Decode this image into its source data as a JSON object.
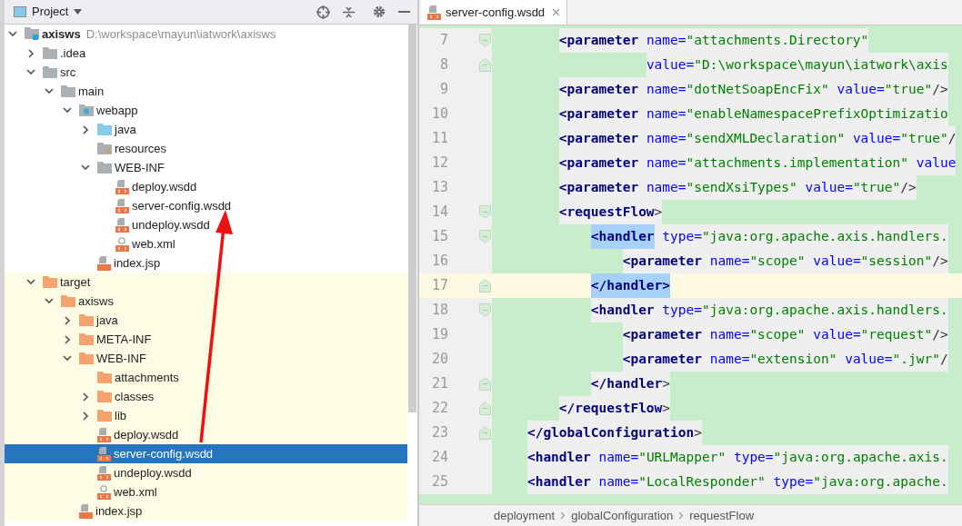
{
  "project_panel": {
    "title": "Project",
    "tree": [
      {
        "name": "axisws",
        "kind": "module",
        "path": "D:\\workspace\\mayun\\iatwork\\axisws",
        "expanded": true,
        "selected": false,
        "children": [
          {
            "name": ".idea",
            "kind": "folder",
            "expanded": false,
            "selected": false
          },
          {
            "name": "src",
            "kind": "folder",
            "expanded": true,
            "selected": false,
            "children": [
              {
                "name": "main",
                "kind": "folder",
                "expanded": true,
                "selected": false,
                "children": [
                  {
                    "name": "webapp",
                    "kind": "web-folder",
                    "expanded": true,
                    "selected": false,
                    "children": [
                      {
                        "name": "java",
                        "kind": "source-folder",
                        "expanded": false,
                        "selected": false
                      },
                      {
                        "name": "resources",
                        "kind": "resource-folder",
                        "selected": false
                      },
                      {
                        "name": "WEB-INF",
                        "kind": "folder",
                        "expanded": true,
                        "selected": false,
                        "children": [
                          {
                            "name": "deploy.wsdd",
                            "kind": "wsdd",
                            "selected": false
                          },
                          {
                            "name": "server-config.wsdd",
                            "kind": "wsdd",
                            "selected": false
                          },
                          {
                            "name": "undeploy.wsdd",
                            "kind": "wsdd",
                            "selected": false
                          },
                          {
                            "name": "web.xml",
                            "kind": "xml",
                            "selected": false
                          }
                        ]
                      },
                      {
                        "name": "index.jsp",
                        "kind": "jsp",
                        "selected": false
                      }
                    ]
                  }
                ]
              }
            ]
          },
          {
            "name": "target",
            "kind": "excluded-folder",
            "expanded": true,
            "selected": false,
            "children": [
              {
                "name": "axisws",
                "kind": "excluded-folder",
                "expanded": true,
                "selected": false,
                "children": [
                  {
                    "name": "java",
                    "kind": "excluded-folder",
                    "expanded": false,
                    "selected": false
                  },
                  {
                    "name": "META-INF",
                    "kind": "excluded-folder",
                    "expanded": false,
                    "selected": false
                  },
                  {
                    "name": "WEB-INF",
                    "kind": "excluded-folder",
                    "expanded": true,
                    "selected": false,
                    "children": [
                      {
                        "name": "attachments",
                        "kind": "excluded-folder",
                        "selected": false
                      },
                      {
                        "name": "classes",
                        "kind": "excluded-folder",
                        "expanded": false,
                        "selected": false
                      },
                      {
                        "name": "lib",
                        "kind": "excluded-folder",
                        "expanded": false,
                        "selected": false
                      },
                      {
                        "name": "deploy.wsdd",
                        "kind": "wsdd",
                        "selected": false
                      },
                      {
                        "name": "server-config.wsdd",
                        "kind": "wsdd",
                        "selected": true
                      },
                      {
                        "name": "undeploy.wsdd",
                        "kind": "wsdd",
                        "selected": false
                      },
                      {
                        "name": "web.xml",
                        "kind": "xml",
                        "selected": false
                      }
                    ]
                  },
                  {
                    "name": "index.jsp",
                    "kind": "jsp",
                    "selected": false
                  }
                ]
              }
            ]
          }
        ]
      }
    ]
  },
  "editor": {
    "tabs": [
      {
        "label": "server-config.wsdd",
        "selected": true
      }
    ],
    "lines": [
      {
        "number": "7",
        "kind": "fold-start",
        "current": false,
        "tokens": [
          {
            "kind": "tag",
            "text": "        <parameter"
          },
          {
            "kind": "attr",
            "text": " name="
          },
          {
            "kind": "string",
            "text": "\"attachments.Directory\""
          }
        ]
      },
      {
        "number": "8",
        "kind": "fold-end",
        "current": false,
        "tokens": [
          {
            "kind": "attr",
            "text": "                   value="
          },
          {
            "kind": "string",
            "text": "\"D:\\workspace\\mayun\\iatwork\\axis"
          }
        ]
      },
      {
        "number": "9",
        "kind": "plain",
        "current": false,
        "tokens": [
          {
            "kind": "tag",
            "text": "        <parameter"
          },
          {
            "kind": "attr",
            "text": " name="
          },
          {
            "kind": "string",
            "text": "\"dotNetSoapEncFix\""
          },
          {
            "kind": "attr",
            "text": " value="
          },
          {
            "kind": "string",
            "text": "\"true\""
          },
          {
            "kind": "punct",
            "text": "/>"
          }
        ]
      },
      {
        "number": "10",
        "kind": "plain",
        "current": false,
        "tokens": [
          {
            "kind": "tag",
            "text": "        <parameter"
          },
          {
            "kind": "attr",
            "text": " name="
          },
          {
            "kind": "string",
            "text": "\"enableNamespacePrefixOptimizatio"
          }
        ]
      },
      {
        "number": "11",
        "kind": "plain",
        "current": false,
        "tokens": [
          {
            "kind": "tag",
            "text": "        <parameter"
          },
          {
            "kind": "attr",
            "text": " name="
          },
          {
            "kind": "string",
            "text": "\"sendXMLDeclaration\""
          },
          {
            "kind": "attr",
            "text": " value="
          },
          {
            "kind": "string",
            "text": "\"true\""
          },
          {
            "kind": "punct",
            "text": "/"
          }
        ]
      },
      {
        "number": "12",
        "kind": "plain",
        "current": false,
        "tokens": [
          {
            "kind": "tag",
            "text": "        <parameter"
          },
          {
            "kind": "attr",
            "text": " name="
          },
          {
            "kind": "string",
            "text": "\"attachments.implementation\""
          },
          {
            "kind": "attr",
            "text": " value"
          }
        ]
      },
      {
        "number": "13",
        "kind": "plain",
        "current": false,
        "tokens": [
          {
            "kind": "tag",
            "text": "        <parameter"
          },
          {
            "kind": "attr",
            "text": " name="
          },
          {
            "kind": "string",
            "text": "\"sendXsiTypes\""
          },
          {
            "kind": "attr",
            "text": " value="
          },
          {
            "kind": "string",
            "text": "\"true\""
          },
          {
            "kind": "punct",
            "text": "/>"
          }
        ]
      },
      {
        "number": "14",
        "kind": "fold-start",
        "current": false,
        "tokens": [
          {
            "kind": "tag",
            "text": "        <requestFlow"
          },
          {
            "kind": "punct",
            "text": ">"
          }
        ]
      },
      {
        "number": "15",
        "kind": "fold-start",
        "current": false,
        "tokens": [
          {
            "kind": "matched",
            "text": "            <handler"
          },
          {
            "kind": "attr",
            "text": " type="
          },
          {
            "kind": "string",
            "text": "\"java:org.apache.axis.handlers."
          }
        ]
      },
      {
        "number": "16",
        "kind": "plain",
        "current": false,
        "tokens": [
          {
            "kind": "tag",
            "text": "                <parameter"
          },
          {
            "kind": "attr",
            "text": " name="
          },
          {
            "kind": "string",
            "text": "\"scope\""
          },
          {
            "kind": "attr",
            "text": " value="
          },
          {
            "kind": "string",
            "text": "\"session\""
          },
          {
            "kind": "punct",
            "text": "/>"
          }
        ]
      },
      {
        "number": "17",
        "kind": "fold-end",
        "current": true,
        "tokens": [
          {
            "kind": "matched",
            "text": "            </handler>"
          }
        ]
      },
      {
        "number": "18",
        "kind": "fold-start",
        "current": false,
        "tokens": [
          {
            "kind": "tag",
            "text": "            <handler"
          },
          {
            "kind": "attr",
            "text": " type="
          },
          {
            "kind": "string",
            "text": "\"java:org.apache.axis.handlers."
          }
        ]
      },
      {
        "number": "19",
        "kind": "plain",
        "current": false,
        "tokens": [
          {
            "kind": "tag",
            "text": "                <parameter"
          },
          {
            "kind": "attr",
            "text": " name="
          },
          {
            "kind": "string",
            "text": "\"scope\""
          },
          {
            "kind": "attr",
            "text": " value="
          },
          {
            "kind": "string",
            "text": "\"request\""
          },
          {
            "kind": "punct",
            "text": "/>"
          }
        ]
      },
      {
        "number": "20",
        "kind": "plain",
        "current": false,
        "tokens": [
          {
            "kind": "tag",
            "text": "                <parameter"
          },
          {
            "kind": "attr",
            "text": " name="
          },
          {
            "kind": "string",
            "text": "\"extension\""
          },
          {
            "kind": "attr",
            "text": " value="
          },
          {
            "kind": "string",
            "text": "\".jwr\""
          },
          {
            "kind": "punct",
            "text": "/"
          }
        ]
      },
      {
        "number": "21",
        "kind": "fold-end",
        "current": false,
        "tokens": [
          {
            "kind": "tag",
            "text": "            </handler"
          },
          {
            "kind": "punct",
            "text": ">"
          }
        ]
      },
      {
        "number": "22",
        "kind": "fold-end",
        "current": false,
        "tokens": [
          {
            "kind": "tag",
            "text": "        </requestFlow"
          },
          {
            "kind": "punct",
            "text": ">"
          }
        ]
      },
      {
        "number": "23",
        "kind": "fold-end",
        "current": false,
        "tokens": [
          {
            "kind": "tag",
            "text": "    </globalConfiguration"
          },
          {
            "kind": "punct",
            "text": ">"
          }
        ]
      },
      {
        "number": "24",
        "kind": "plain",
        "current": false,
        "tokens": [
          {
            "kind": "tag",
            "text": "    <handler"
          },
          {
            "kind": "attr",
            "text": " name="
          },
          {
            "kind": "string",
            "text": "\"URLMapper\""
          },
          {
            "kind": "attr",
            "text": " type="
          },
          {
            "kind": "string",
            "text": "\"java:org.apache.axis."
          }
        ]
      },
      {
        "number": "25",
        "kind": "plain",
        "current": false,
        "tokens": [
          {
            "kind": "tag",
            "text": "    <handler"
          },
          {
            "kind": "attr",
            "text": " name="
          },
          {
            "kind": "string",
            "text": "\"LocalResponder\""
          },
          {
            "kind": "attr",
            "text": " type="
          },
          {
            "kind": "string",
            "text": "\"java:org.apache."
          }
        ]
      }
    ],
    "breadcrumbs": [
      "deployment",
      "globalConfiguration",
      "requestFlow"
    ]
  }
}
